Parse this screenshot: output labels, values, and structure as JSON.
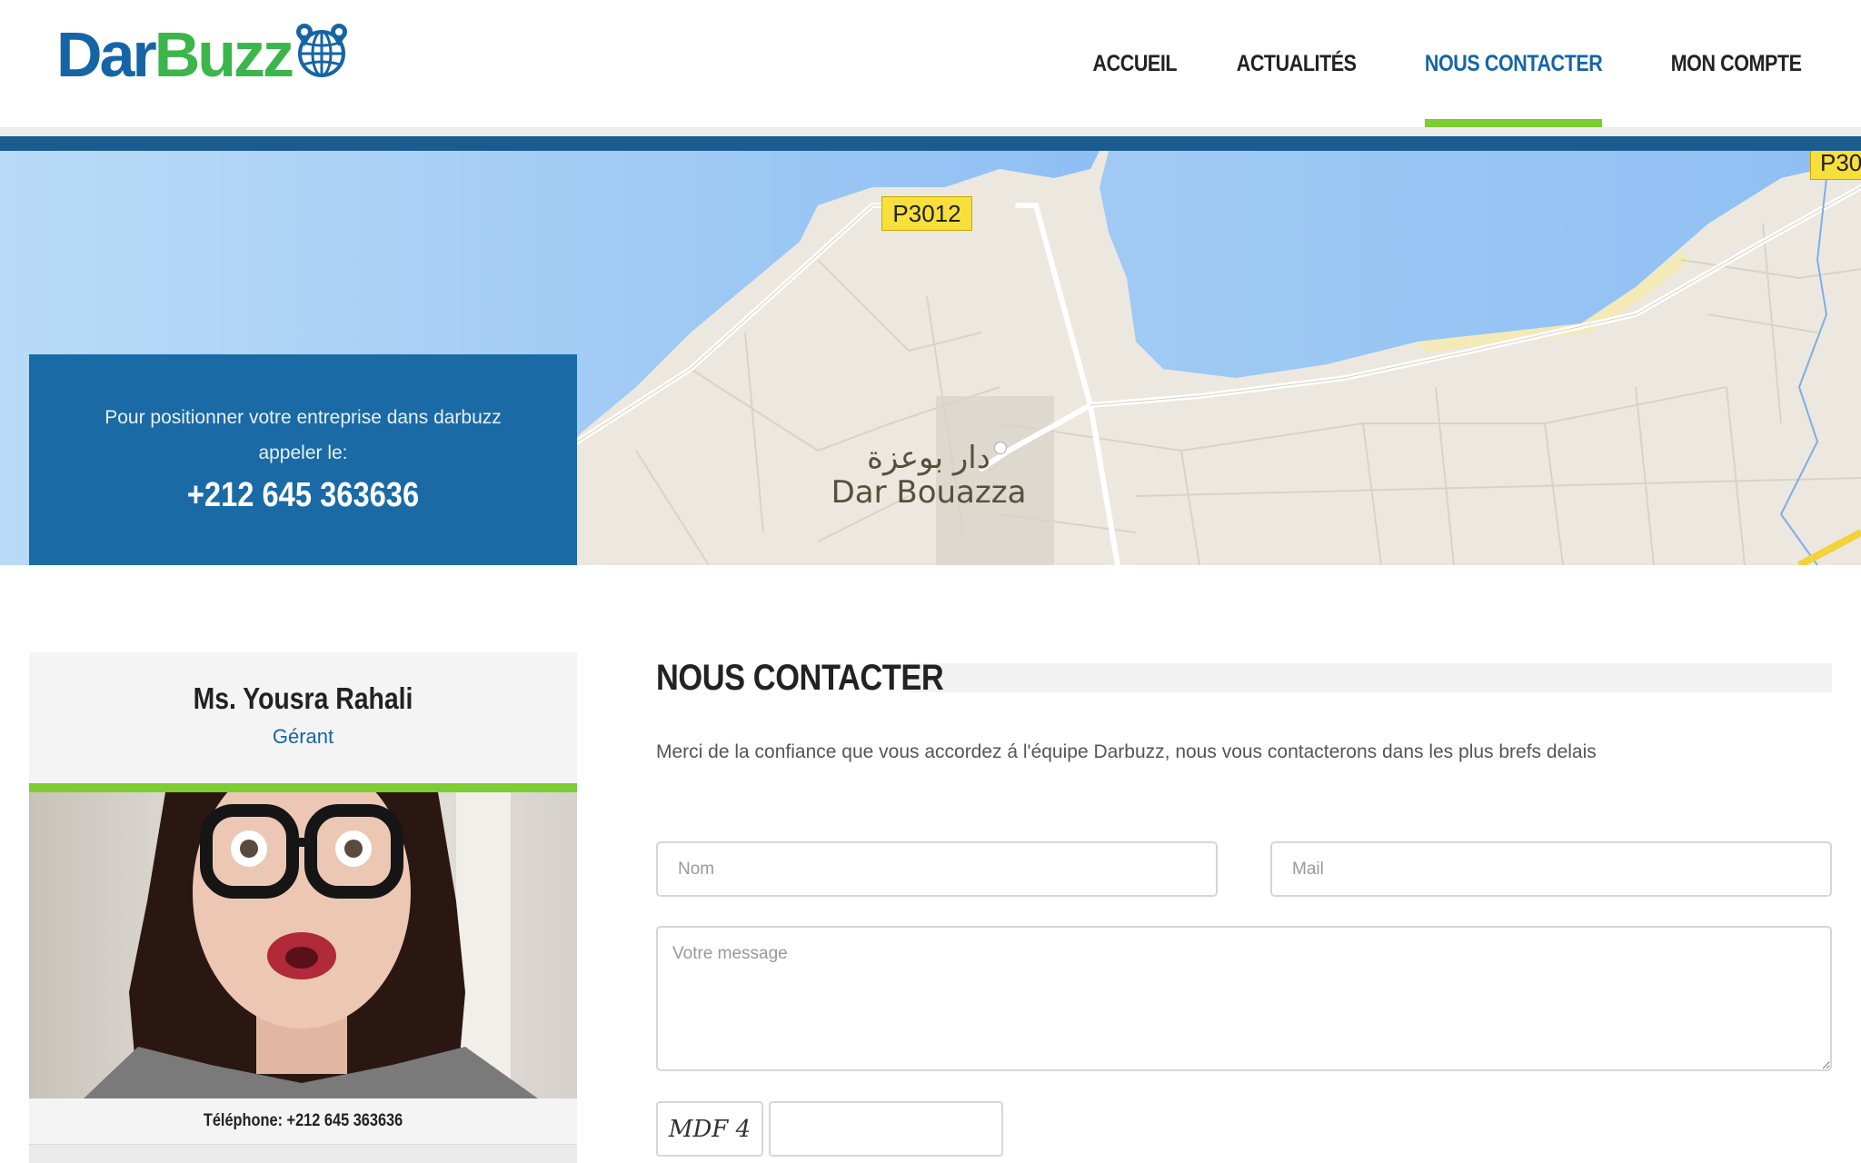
{
  "brand": {
    "part1": "Dar",
    "part2": "Buzz",
    "color_dark": "#1565a6",
    "color_green": "#3cb54a"
  },
  "nav": {
    "items": [
      {
        "label": "ACCUEIL",
        "active": false
      },
      {
        "label": "ACTUALITÉS",
        "active": false
      },
      {
        "label": "NOUS CONTACTER",
        "active": true
      },
      {
        "label": "MON COMPTE",
        "active": false
      }
    ],
    "active_color": "#1565a6",
    "indicator_color": "#7ccc32"
  },
  "map": {
    "road_labels": [
      "P3012",
      "P30"
    ],
    "place_arabic": "دار بوعزة",
    "place_latin": "Dar Bouazza"
  },
  "call_box": {
    "line1": "Pour positionner votre entreprise dans darbuzz",
    "line2": "appeler le:",
    "phone": "+212 645 363636"
  },
  "profile": {
    "name": "Ms. Yousra Rahali",
    "role": "Gérant",
    "phone_line": "Téléphone: +212 645 363636"
  },
  "contact": {
    "title": "NOUS CONTACTER",
    "intro": "Merci de la confiance que vous accordez á l'équipe Darbuzz, nous vous contacterons dans les plus brefs delais",
    "name_placeholder": "Nom",
    "mail_placeholder": "Mail",
    "message_placeholder": "Votre message",
    "captcha_text": "MDF 4"
  }
}
